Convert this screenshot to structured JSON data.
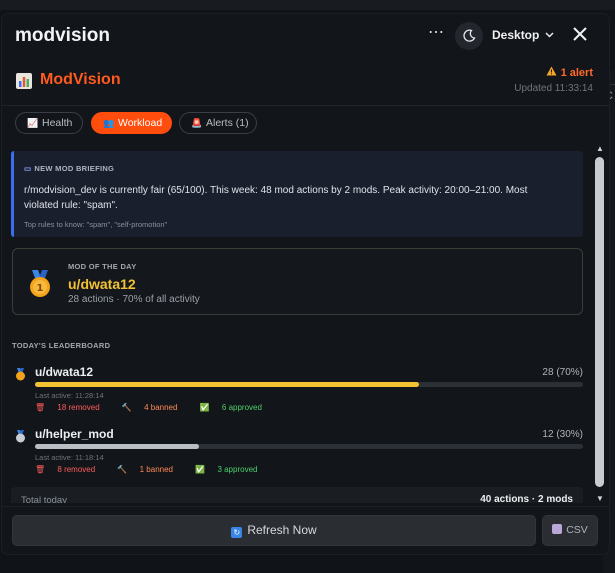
{
  "window": {
    "title": "modvision",
    "more_glyph": "⋯",
    "view_select": "Desktop"
  },
  "brand": {
    "name": "ModVision",
    "alert_text": "1 alert",
    "updated": "Updated 11:33:14",
    "accent": "#ff5a1f"
  },
  "tabs": [
    {
      "label": "Health",
      "icon": "chart-icon",
      "active": false
    },
    {
      "label": "Workload",
      "icon": "people-icon",
      "active": true
    },
    {
      "label": "Alerts (1)",
      "icon": "siren-icon",
      "active": false
    }
  ],
  "briefing": {
    "heading": "NEW MOD BRIEFING",
    "body": "r/modvision_dev is currently fair (65/100). This week: 48 mod actions by 2 mods. Peak activity: 20:00–21:00. Most violated rule: \"spam\".",
    "rules": "Top rules to know: \"spam\", \"self-promotion\""
  },
  "mod_of_day": {
    "label": "MOD OF THE DAY",
    "user": "u/dwata12",
    "summary": "28 actions · 70% of all activity"
  },
  "leaderboard": {
    "title": "TODAY'S LEADERBOARD",
    "rows": [
      {
        "name": "u/dwata12",
        "count": "28 (70%)",
        "share": 0.7,
        "bar_color": "#f3c233",
        "last_active": "Last active: 11:28:14",
        "removed": "18 removed",
        "banned": "4 banned",
        "approved": "6 approved"
      },
      {
        "name": "u/helper_mod",
        "count": "12 (30%)",
        "share": 0.3,
        "bar_color": "#b9bdc4",
        "last_active": "Last active: 11:18:14",
        "removed": "8 removed",
        "banned": "1 banned",
        "approved": "3 approved"
      }
    ]
  },
  "totals": {
    "label": "Total today",
    "value": "40 actions · 2 mods"
  },
  "footer": {
    "refresh": "Refresh Now",
    "csv": "CSV"
  },
  "edge_char": "C"
}
